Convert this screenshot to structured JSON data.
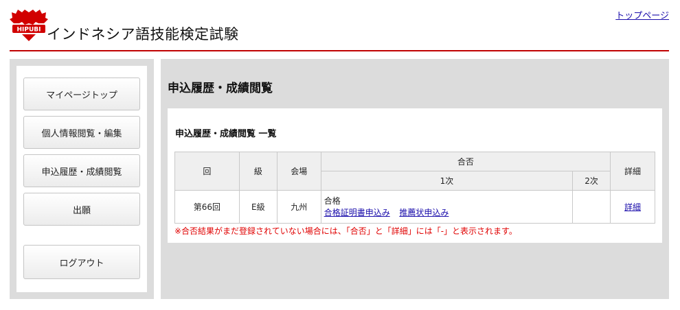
{
  "header": {
    "logo_text": "HIPUBI",
    "site_title": "インドネシア語技能検定試験",
    "top_link": "トップページ",
    "accent_color": "#c00000"
  },
  "sidebar": {
    "items": [
      {
        "label": "マイページトップ"
      },
      {
        "label": "個人情報閲覧・編集"
      },
      {
        "label": "申込履歴・成績閲覧"
      },
      {
        "label": "出願"
      },
      {
        "label": "ログアウト"
      }
    ]
  },
  "main": {
    "page_title": "申込履歴・成績閲覧",
    "panel_title": "申込履歴・成績閲覧 一覧",
    "table": {
      "headers": {
        "round": "回",
        "grade": "級",
        "venue": "会場",
        "result": "合否",
        "first": "1次",
        "second": "2次",
        "detail": "詳細"
      },
      "rows": [
        {
          "round": "第66回",
          "grade": "E級",
          "venue": "九州",
          "first_status": "合格",
          "link_certificate": "合格証明書申込み",
          "link_recommendation": "推薦状申込み",
          "second": "",
          "detail_link": "詳細"
        }
      ]
    },
    "note": "※合否結果がまだ登録されていない場合には、「合否」と「詳細」には「-」と表示されます。"
  }
}
